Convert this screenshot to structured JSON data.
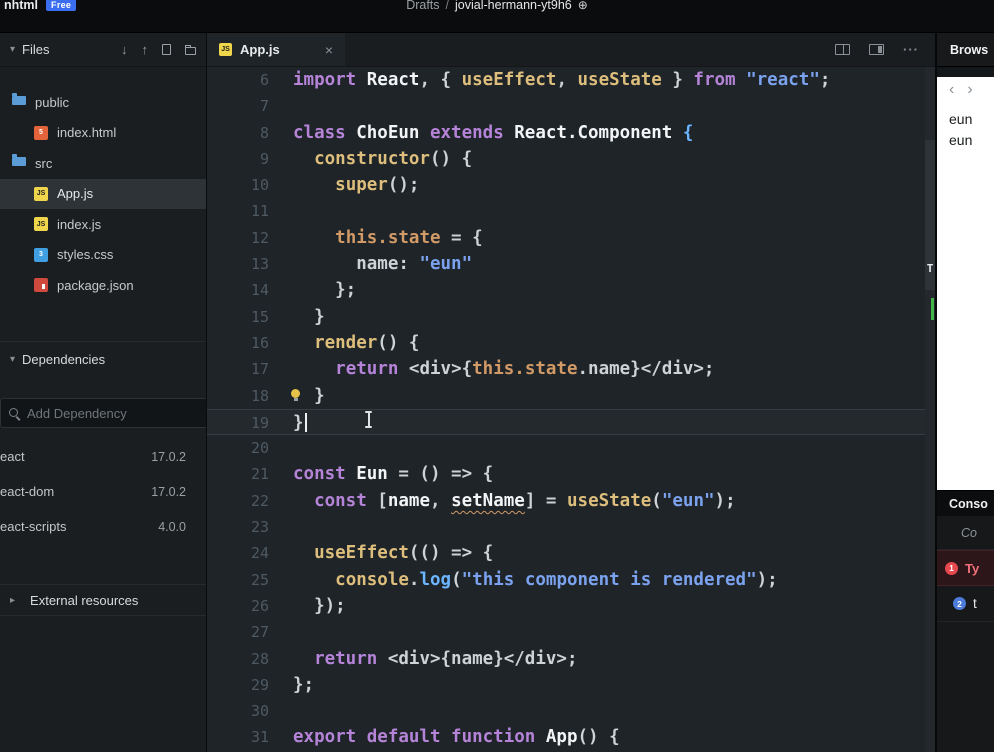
{
  "icons": {
    "collapse": "▾",
    "expand": "▸",
    "download": "↓",
    "upload": "↑",
    "close": "×",
    "globe": "⊕",
    "back": "‹",
    "forward": "›",
    "more": "···"
  },
  "topbar": {
    "project": "nhtml",
    "plan_badge": "Free",
    "breadcrumb": {
      "section": "Drafts",
      "separator": "/",
      "name": "jovial-hermann-yt9h6"
    }
  },
  "sidebar": {
    "files_header": "Files",
    "tree": [
      {
        "label": "public",
        "icon": "folder",
        "indent": 0
      },
      {
        "label": "index.html",
        "icon": "html",
        "indent": 1
      },
      {
        "label": "src",
        "icon": "folder",
        "indent": 0
      },
      {
        "label": "App.js",
        "icon": "js",
        "indent": 1,
        "selected": true
      },
      {
        "label": "index.js",
        "icon": "js",
        "indent": 1
      },
      {
        "label": "styles.css",
        "icon": "css",
        "indent": 1
      },
      {
        "label": "package.json",
        "icon": "pkg",
        "indent": 1
      }
    ],
    "dependencies_header": "Dependencies",
    "search_placeholder": "Add Dependency",
    "dependencies": [
      {
        "name": "eact",
        "version": "17.0.2"
      },
      {
        "name": "eact-dom",
        "version": "17.0.2"
      },
      {
        "name": "eact-scripts",
        "version": "4.0.0"
      }
    ],
    "external_header": "External resources"
  },
  "editor": {
    "tab_label": "App.js",
    "active_line": 19,
    "lightbulb_line": 18,
    "ruler_marker": "T",
    "lines": [
      {
        "n": 6,
        "s": [
          [
            "kw",
            "import "
          ],
          [
            "id",
            "React"
          ],
          [
            "pl",
            ", { "
          ],
          [
            "fn",
            "useEffect"
          ],
          [
            "pl",
            ", "
          ],
          [
            "fn",
            "useState"
          ],
          [
            "pl",
            " } "
          ],
          [
            "kw",
            "from "
          ],
          [
            "str",
            "\"react\""
          ],
          [
            "pl",
            ";"
          ]
        ]
      },
      {
        "n": 7,
        "s": []
      },
      {
        "n": 8,
        "s": [
          [
            "kw",
            "class "
          ],
          [
            "id",
            "ChoEun"
          ],
          [
            "kw",
            " extends "
          ],
          [
            "id",
            "React.Component"
          ],
          [
            "pb",
            " {"
          ]
        ]
      },
      {
        "n": 9,
        "s": [
          [
            "pl",
            "  "
          ],
          [
            "fn",
            "constructor"
          ],
          [
            "pl",
            "() {"
          ]
        ]
      },
      {
        "n": 10,
        "s": [
          [
            "pl",
            "    "
          ],
          [
            "fn",
            "super"
          ],
          [
            "pl",
            "();"
          ]
        ]
      },
      {
        "n": 11,
        "s": []
      },
      {
        "n": 12,
        "s": [
          [
            "pl",
            "    "
          ],
          [
            "or",
            "this.state"
          ],
          [
            "pl",
            " = {"
          ]
        ]
      },
      {
        "n": 13,
        "s": [
          [
            "pl",
            "      name: "
          ],
          [
            "str",
            "\"eun\""
          ]
        ]
      },
      {
        "n": 14,
        "s": [
          [
            "pl",
            "    };"
          ]
        ]
      },
      {
        "n": 15,
        "s": [
          [
            "pl",
            "  }"
          ]
        ]
      },
      {
        "n": 16,
        "s": [
          [
            "pl",
            "  "
          ],
          [
            "fn",
            "render"
          ],
          [
            "pl",
            "() {"
          ]
        ]
      },
      {
        "n": 17,
        "s": [
          [
            "pl",
            "    "
          ],
          [
            "kw",
            "return "
          ],
          [
            "pl",
            "<div>{"
          ],
          [
            "or",
            "this.state"
          ],
          [
            "pl",
            ".name}</div>;"
          ]
        ]
      },
      {
        "n": 18,
        "s": [
          [
            "pl",
            "  }"
          ]
        ]
      },
      {
        "n": 19,
        "s": [
          [
            "pl",
            "}"
          ]
        ]
      },
      {
        "n": 20,
        "s": []
      },
      {
        "n": 21,
        "s": [
          [
            "kw",
            "const "
          ],
          [
            "id",
            "Eun"
          ],
          [
            "pl",
            " = () => {"
          ]
        ]
      },
      {
        "n": 22,
        "s": [
          [
            "pl",
            "  "
          ],
          [
            "kw",
            "const "
          ],
          [
            "pl",
            "["
          ],
          [
            "id",
            "name"
          ],
          [
            "pl",
            ", "
          ],
          [
            "id sq",
            "setName"
          ],
          [
            "pl",
            "] = "
          ],
          [
            "fn",
            "useState"
          ],
          [
            "pl",
            "("
          ],
          [
            "str",
            "\"eun\""
          ],
          [
            "pl",
            ");"
          ]
        ]
      },
      {
        "n": 23,
        "s": []
      },
      {
        "n": 24,
        "s": [
          [
            "pl",
            "  "
          ],
          [
            "fn",
            "useEffect"
          ],
          [
            "pl",
            "(() => {"
          ]
        ]
      },
      {
        "n": 25,
        "s": [
          [
            "pl",
            "    "
          ],
          [
            "fn",
            "console"
          ],
          [
            "pl",
            "."
          ],
          [
            "pb",
            "log"
          ],
          [
            "pl",
            "("
          ],
          [
            "str",
            "\"this component is rendered\""
          ],
          [
            "pl",
            ");"
          ]
        ]
      },
      {
        "n": 26,
        "s": [
          [
            "pl",
            "  });"
          ]
        ]
      },
      {
        "n": 27,
        "s": []
      },
      {
        "n": 28,
        "s": [
          [
            "pl",
            "  "
          ],
          [
            "kw",
            "return "
          ],
          [
            "pl",
            "<div>{name}</div>;"
          ]
        ]
      },
      {
        "n": 29,
        "s": [
          [
            "pl",
            "};"
          ]
        ]
      },
      {
        "n": 30,
        "s": []
      },
      {
        "n": 31,
        "s": [
          [
            "kw",
            "export default function "
          ],
          [
            "id",
            "App"
          ],
          [
            "pl",
            "() {"
          ]
        ]
      }
    ]
  },
  "preview": {
    "tab_label": "Brows",
    "output_lines": [
      "eun",
      "eun"
    ],
    "console_header": "Conso",
    "console_meta": "Co",
    "console_rows": [
      {
        "badge": "1",
        "text": "Ty",
        "kind": "error"
      },
      {
        "badge": "2",
        "text": "t",
        "kind": "info"
      }
    ]
  }
}
